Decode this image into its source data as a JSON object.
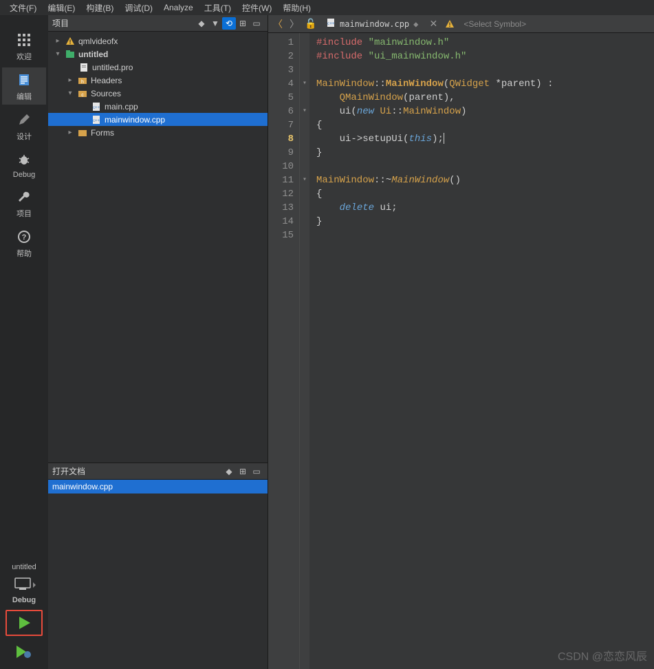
{
  "menubar": {
    "file": "文件(F)",
    "edit": "编辑(E)",
    "build": "构建(B)",
    "debug": "调试(D)",
    "analyze": "Analyze",
    "tools": "工具(T)",
    "widgets": "控件(W)",
    "help": "帮助(H)"
  },
  "leftStrip": {
    "welcome": "欢迎",
    "edit": "编辑",
    "design": "设计",
    "debug": "Debug",
    "project": "项目",
    "help": "帮助"
  },
  "kit": {
    "name": "untitled",
    "config": "Debug"
  },
  "projectPanel": {
    "title": "项目",
    "tree": {
      "root1": "qmlvideofx",
      "root2": "untitled",
      "proFile": "untitled.pro",
      "headers": "Headers",
      "sources": "Sources",
      "mainCpp": "main.cpp",
      "mainWindowCpp": "mainwindow.cpp",
      "forms": "Forms"
    }
  },
  "openDocs": {
    "title": "打开文档",
    "items": [
      "mainwindow.cpp"
    ]
  },
  "editorBar": {
    "file": "mainwindow.cpp",
    "symbol": "<Select Symbol>"
  },
  "code": {
    "lines": [
      {
        "n": 1,
        "html": "<span class='kw-pre'>#include</span> <span class='kw-str'>\"mainwindow.h\"</span>"
      },
      {
        "n": 2,
        "html": "<span class='kw-pre'>#include</span> <span class='kw-str'>\"ui_mainwindow.h\"</span>"
      },
      {
        "n": 3,
        "html": ""
      },
      {
        "n": 4,
        "html": "<span class='kw-type'>MainWindow</span><span class='kw-op'>::</span><span class='kw-typeB'>MainWindow</span><span class='kw-op'>(</span><span class='kw-type'>QWidget</span> <span class='kw-op'>*</span><span class='kw-id'>parent</span><span class='kw-op'>) :</span>"
      },
      {
        "n": 5,
        "html": "    <span class='kw-type'>QMainWindow</span><span class='kw-op'>(</span><span class='kw-id'>parent</span><span class='kw-op'>),</span>"
      },
      {
        "n": 6,
        "html": "    <span class='kw-id'>ui</span><span class='kw-op'>(</span><span class='kw-new'>new</span> <span class='kw-type'>Ui</span><span class='kw-op'>::</span><span class='kw-type'>MainWindow</span><span class='kw-op'>)</span>"
      },
      {
        "n": 7,
        "html": "<span class='kw-op'>{</span>"
      },
      {
        "n": 8,
        "html": "    <span class='kw-id'>ui</span><span class='kw-op'>-&gt;</span><span class='kw-id'>setupUi</span><span class='kw-op'>(</span><span class='kw-this'>this</span><span class='kw-op'>);</span><span class='caret'></span>",
        "current": true
      },
      {
        "n": 9,
        "html": "<span class='kw-op'>}</span>"
      },
      {
        "n": 10,
        "html": ""
      },
      {
        "n": 11,
        "html": "<span class='kw-type'>MainWindow</span><span class='kw-op'>::~</span><span class='kw-typeI'>MainWindow</span><span class='kw-op'>()</span>"
      },
      {
        "n": 12,
        "html": "<span class='kw-op'>{</span>"
      },
      {
        "n": 13,
        "html": "    <span class='kw-del'>delete</span> <span class='kw-id'>ui</span><span class='kw-op'>;</span>"
      },
      {
        "n": 14,
        "html": "<span class='kw-op'>}</span>"
      },
      {
        "n": 15,
        "html": ""
      }
    ],
    "folds": {
      "4": "▾",
      "6": "▾",
      "11": "▾"
    }
  },
  "watermark": "CSDN @恋恋风辰"
}
